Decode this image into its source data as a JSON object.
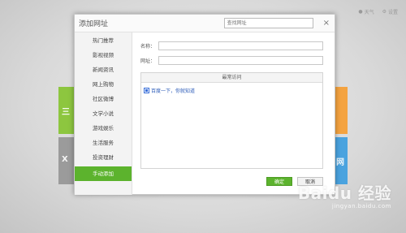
{
  "background": {
    "top_right": [
      {
        "icon": "location-pin-icon",
        "label": "天气"
      },
      {
        "icon": "settings-icon",
        "label": "设置"
      }
    ],
    "tiles": [
      {
        "color": "#8dc63f",
        "glyph": "三"
      },
      {
        "color": "#9b9b9b",
        "glyph": "X"
      },
      {
        "color": "#f4a340",
        "glyph": ""
      },
      {
        "color": "#4aa3df",
        "glyph": "网"
      }
    ]
  },
  "dialog": {
    "title": "添加网址",
    "search_placeholder": "查找网址",
    "close_glyph": "×"
  },
  "sidebar": {
    "items": [
      {
        "label": "热门推荐"
      },
      {
        "label": "影视视频"
      },
      {
        "label": "新闻资讯"
      },
      {
        "label": "网上购物"
      },
      {
        "label": "社区微博"
      },
      {
        "label": "文学小说"
      },
      {
        "label": "游戏娱乐"
      },
      {
        "label": "生活服务"
      },
      {
        "label": "投资理财"
      },
      {
        "label": "手动添加",
        "active": true
      }
    ]
  },
  "form": {
    "name_label": "名称：",
    "name_value": "",
    "url_label": "网址：",
    "url_value": ""
  },
  "recent": {
    "header": "最常访问",
    "items": [
      {
        "icon": "baidu-favicon-icon",
        "label": "百度一下，你就知道"
      }
    ]
  },
  "buttons": {
    "ok": "确定",
    "cancel": "取消"
  },
  "colors": {
    "accent": "#5cb32d",
    "link": "#2b5bb8"
  },
  "watermark": {
    "logo": "Baidu 经验",
    "url": "jingyan.baidu.com"
  }
}
